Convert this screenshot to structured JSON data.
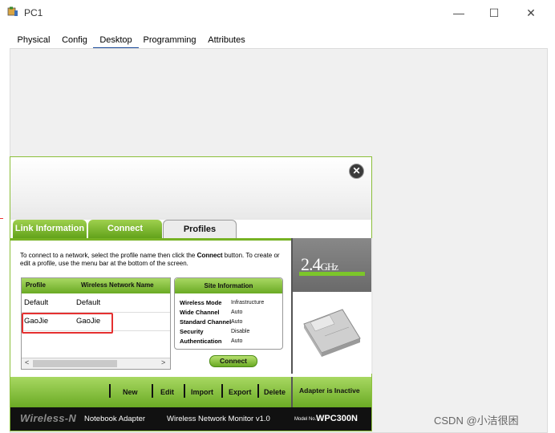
{
  "window": {
    "title": "PC1",
    "controls": [
      "—",
      "☐",
      "✕"
    ]
  },
  "tabs": [
    "Physical",
    "Config",
    "Desktop",
    "Programming",
    "Attributes"
  ],
  "active_tab": "Desktop",
  "monitor": {
    "close_label": "✕",
    "tabs": [
      "Link Information",
      "Connect",
      "Profiles"
    ],
    "active_tab": "Profiles",
    "instruction_before": "To connect to a network, select the profile name then click the ",
    "instruction_bold": "Connect",
    "instruction_after": " button. To create or edit a profile, use the menu bar at the bottom of the screen.",
    "profiles": {
      "headers": [
        "Profile",
        "Wireless Network Name"
      ],
      "rows": [
        {
          "profile": "Default",
          "network": "Default"
        },
        {
          "profile": "GaoJie",
          "network": "GaoJie"
        }
      ],
      "scroll_left": "<",
      "scroll_right": ">"
    },
    "site_info": {
      "title": "Site Information",
      "items": [
        {
          "key": "Wireless Mode",
          "value": "Infrastructure"
        },
        {
          "key": "Wide Channel",
          "value": "Auto"
        },
        {
          "key": "Standard Channel",
          "value": "Auto"
        },
        {
          "key": "Security",
          "value": "Disable"
        },
        {
          "key": "Authentication",
          "value": "Auto"
        }
      ]
    },
    "connect_button": "Connect",
    "band": {
      "number": "2.4",
      "unit": "GHz"
    },
    "actions": [
      "New",
      "Edit",
      "Import",
      "Export",
      "Delete"
    ],
    "adapter_status": "Adapter is Inactive",
    "footer": {
      "brand": "Wireless-N",
      "product": "Notebook Adapter",
      "app": "Wireless Network Monitor  v1.0",
      "model_label": "Model No.",
      "model": "WPC300N"
    }
  },
  "watermark": "CSDN @小洁很困",
  "colors": {
    "green_light": "#a8d862",
    "green_dark": "#6aaa24",
    "selection": "#e53030"
  }
}
